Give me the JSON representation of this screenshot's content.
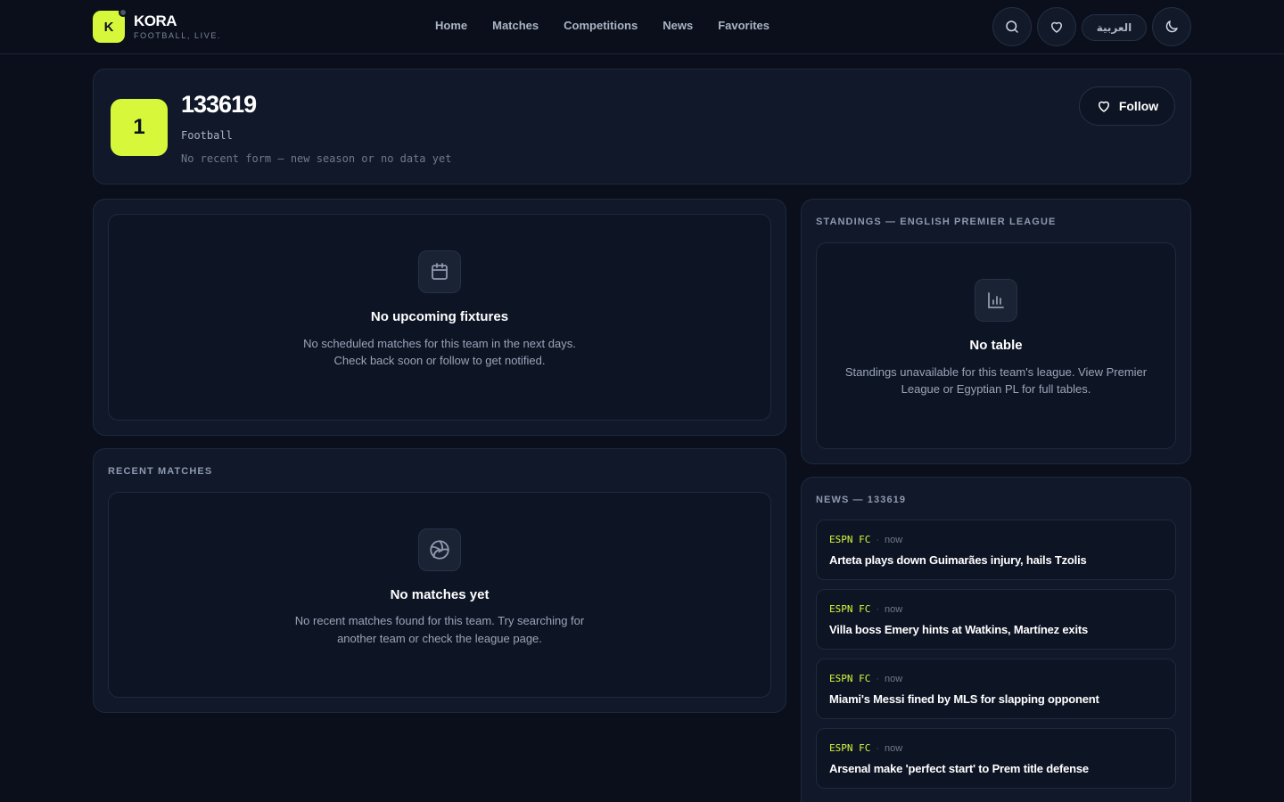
{
  "brand": {
    "logo_letter": "K",
    "name": "KORA",
    "tagline": "FOOTBALL, LIVE."
  },
  "nav": [
    "Home",
    "Matches",
    "Competitions",
    "News",
    "Favorites"
  ],
  "header": {
    "lang_label": "العربية",
    "icons": [
      "search-icon",
      "heart-icon",
      "moon-icon"
    ]
  },
  "team": {
    "crest": "1",
    "name": "133619",
    "sport": "Football",
    "form_text": "No recent form — new season or no data yet",
    "follow_label": "Follow"
  },
  "fixtures": {
    "title": "No upcoming fixtures",
    "desc1": "No scheduled matches for this team in the next days.",
    "desc2": "Check back soon or follow to get notified.",
    "icon": "calendar-icon"
  },
  "recent": {
    "section": "RECENT MATCHES",
    "title": "No matches yet",
    "desc1": "No recent matches found for this team. Try searching for",
    "desc2": "another team or check the league page.",
    "icon": "football-icon"
  },
  "standings": {
    "section": "STANDINGS — ENGLISH PREMIER LEAGUE",
    "title": "No table",
    "desc1": "Standings unavailable for this team's league. View Premier",
    "desc2": "League or Egyptian PL for full tables.",
    "icon": "bar-chart-icon"
  },
  "news": {
    "section": "NEWS — 133619",
    "items": [
      {
        "source": "ESPN FC",
        "time": "now",
        "title": "Arteta plays down Guimarães injury, hails Tzolis"
      },
      {
        "source": "ESPN FC",
        "time": "now",
        "title": "Villa boss Emery hints at Watkins, Martínez exits"
      },
      {
        "source": "ESPN FC",
        "time": "now",
        "title": "Miami's Messi fined by MLS for slapping opponent"
      },
      {
        "source": "ESPN FC",
        "time": "now",
        "title": "Arsenal make 'perfect start' to Prem title defense"
      }
    ]
  },
  "colors": {
    "accent": "#d7f83a",
    "background": "#0a0f1b",
    "card": "#101829"
  }
}
